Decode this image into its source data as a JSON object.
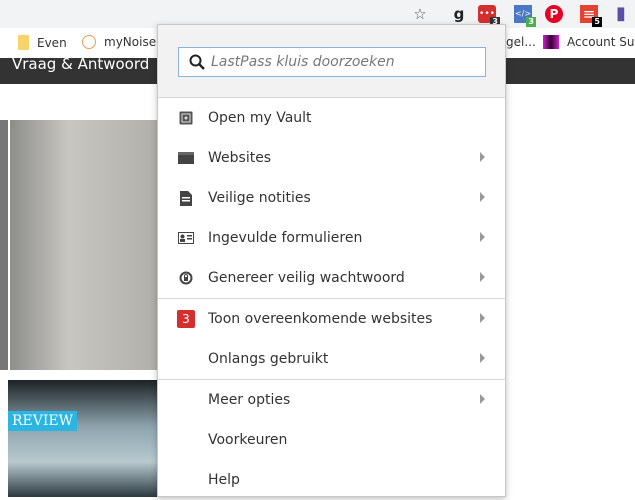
{
  "toolbar": {
    "extensions": [
      {
        "icon": "star-icon",
        "glyph": "☆"
      },
      {
        "icon": "grammarly-icon",
        "glyph": "g"
      },
      {
        "icon": "lastpass-icon",
        "glyph": "•••",
        "badge": "3",
        "badge_color": "#333"
      },
      {
        "icon": "code-icon",
        "glyph": "</>",
        "badge": "3",
        "badge_color": "#4caf50"
      },
      {
        "icon": "pinterest-icon",
        "glyph": "P"
      },
      {
        "icon": "todoist-icon",
        "glyph": "≡",
        "badge": "5",
        "badge_color": "#000"
      },
      {
        "icon": "books-icon",
        "glyph": "▮"
      }
    ]
  },
  "bookmarks": [
    {
      "label": "Even"
    },
    {
      "label": "myNoise -"
    },
    {
      "label": "gel..."
    },
    {
      "label": "Account Susp"
    }
  ],
  "page": {
    "header": "Vraag & Antwoord",
    "review_tag": "REVIEW"
  },
  "popup": {
    "search_placeholder": "LastPass kluis doorzoeken",
    "groups": [
      [
        {
          "label": "Open my Vault",
          "icon": "vault-icon",
          "arrow": false
        },
        {
          "label": "Websites",
          "icon": "websites-icon",
          "arrow": true
        },
        {
          "label": "Veilige notities",
          "icon": "note-icon",
          "arrow": true
        },
        {
          "label": "Ingevulde formulieren",
          "icon": "form-icon",
          "arrow": true
        },
        {
          "label": "Genereer veilig wachtwoord",
          "icon": "generate-icon",
          "arrow": true
        }
      ],
      [
        {
          "label": "Toon overeenkomende websites",
          "count": "3",
          "arrow": true
        },
        {
          "label": "Onlangs gebruikt",
          "arrow": true
        }
      ],
      [
        {
          "label": "Meer opties",
          "arrow": true
        },
        {
          "label": "Voorkeuren",
          "arrow": false
        },
        {
          "label": "Help",
          "arrow": false
        }
      ]
    ]
  }
}
